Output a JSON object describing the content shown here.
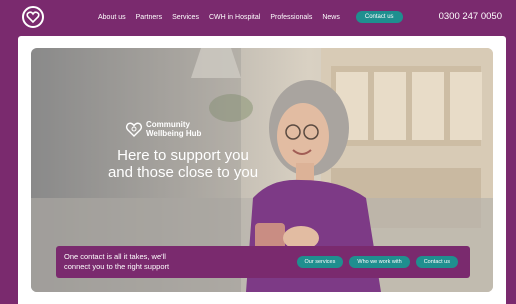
{
  "header": {
    "logo_icon": "heart-logo-icon",
    "nav": [
      {
        "label": "About us"
      },
      {
        "label": "Partners"
      },
      {
        "label": "Services"
      },
      {
        "label": "CWH in Hospital"
      },
      {
        "label": "Professionals"
      },
      {
        "label": "News"
      }
    ],
    "contact_label": "Contact us",
    "phone": "0300 247 0050"
  },
  "hero": {
    "brand_line1": "Community",
    "brand_line2": "Wellbeing Hub",
    "headline_line1": "Here to support you",
    "headline_line2": "and those close to you",
    "cta_text_line1": "One contact is all it takes, we'll",
    "cta_text_line2": "connect you to the right support",
    "buttons": [
      {
        "label": "Our services"
      },
      {
        "label": "Who we work with"
      },
      {
        "label": "Contact us"
      }
    ]
  },
  "colors": {
    "brand_purple": "#7a2a6e",
    "teal": "#1f8f8f",
    "white": "#ffffff"
  }
}
